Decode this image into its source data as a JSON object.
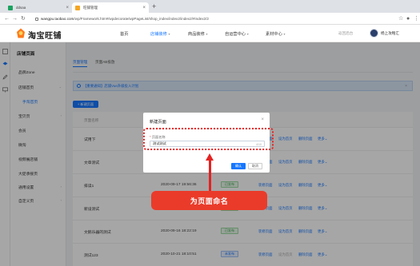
{
  "browser": {
    "tabs": [
      {
        "title": "ddsaa",
        "favicon_color": "#1aa260"
      },
      {
        "title": "旺铺管理",
        "favicon_color": "#f5a623"
      }
    ],
    "new_tab": "+",
    "url_host": "wangpu.taobao.com",
    "url_path": "/wp/Framework.htm#/wpdecorate/wpPageList/shop_index/index2/index2/#index2/2"
  },
  "header": {
    "logo_text": "淘宝旺铺",
    "nav": [
      {
        "label": "首页",
        "active": false,
        "caret": false
      },
      {
        "label": "店铺装修",
        "active": true,
        "caret": true
      },
      {
        "label": "商品装修",
        "active": false,
        "caret": true
      },
      {
        "label": "自运营中心",
        "active": false,
        "caret": true
      },
      {
        "label": "素材中心",
        "active": false,
        "caret": true
      }
    ],
    "back_link": "返回后台",
    "username": "杨上攻略汇"
  },
  "sidebar": {
    "title": "店铺页面",
    "items": [
      {
        "label": "品牌Zone",
        "sub": false,
        "active": false,
        "arrow": ""
      },
      {
        "label": "店铺首页",
        "sub": false,
        "active": false,
        "arrow": "⌄"
      },
      {
        "label": "手淘首页",
        "sub": true,
        "active": true,
        "arrow": ""
      },
      {
        "label": "宝贝页",
        "sub": false,
        "active": false,
        "arrow": "›"
      },
      {
        "label": "会员",
        "sub": false,
        "active": false,
        "arrow": ""
      },
      {
        "label": "微淘",
        "sub": false,
        "active": false,
        "arrow": ""
      },
      {
        "label": "视频展店铺",
        "sub": false,
        "active": false,
        "arrow": ""
      },
      {
        "label": "大促承接页",
        "sub": false,
        "active": false,
        "arrow": ""
      },
      {
        "label": "通用设置",
        "sub": false,
        "active": false,
        "arrow": "›"
      },
      {
        "label": "自定义页",
        "sub": false,
        "active": false,
        "arrow": "›"
      }
    ]
  },
  "content": {
    "tabs": [
      "页面管理",
      "页面AB投放"
    ],
    "notice": "【重要通知】店铺Vue升级投入计划",
    "new_page_button": "+ 新建页面",
    "columns": [
      "页面名称",
      "",
      "",
      ""
    ],
    "rows": [
      {
        "name": "试用下",
        "time": "",
        "badge": "",
        "badge_color": "",
        "actions": [
          "装修页面",
          "设为首页",
          "删除页面",
          "更多"
        ]
      },
      {
        "name": "文章测试",
        "time": "",
        "badge": "",
        "badge_color": "",
        "actions": [
          "装修页面",
          "设为首页",
          "删除页面",
          "更多"
        ]
      },
      {
        "name": "排读1",
        "time": "2020-09-17 19:56:36",
        "badge": "已发布",
        "badge_color": "green",
        "actions": [
          "装修页面",
          "设为首页",
          "删除页面",
          "更多"
        ]
      },
      {
        "name": "新设测试",
        "time": "2020-09-15 10:33:20",
        "badge": "已发布",
        "badge_color": "green",
        "actions": [
          "装修页面",
          "设为首页",
          "删除页面",
          "更多"
        ]
      },
      {
        "name": "文鹅乐器的测试",
        "time": "2020-09-16 18:22:19",
        "badge": "已发布",
        "badge_color": "green",
        "actions": [
          "装修页面",
          "设为首页",
          "删除页面",
          "更多"
        ]
      },
      {
        "name": "测试123",
        "time": "2020-10-21 18:10:51",
        "badge": "未发布",
        "badge_color": "blue",
        "actions": [
          "装修页面",
          "设为首页",
          "删除页面",
          "更多"
        ]
      }
    ]
  },
  "modal": {
    "title": "新建页面",
    "close": "×",
    "field_label_req": "*",
    "field_label": "页面名称",
    "field_value": "测试测试",
    "field_count": "4/10",
    "confirm": "确认",
    "cancel": "取消"
  },
  "annotation": {
    "callout": "为页面命名",
    "color": "#e52222"
  }
}
